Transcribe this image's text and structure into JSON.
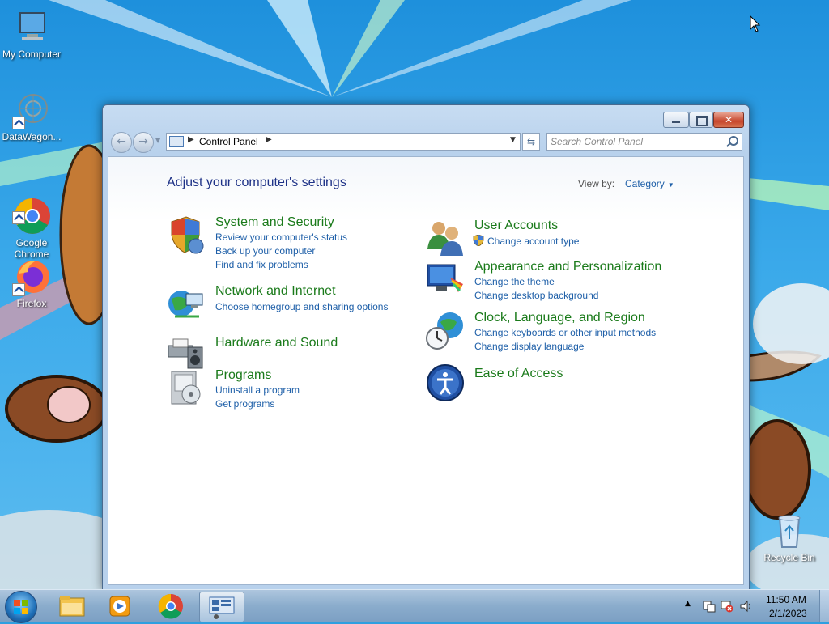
{
  "desktop": {
    "icons": [
      {
        "label": "My Computer"
      },
      {
        "label": "DataWagon..."
      },
      {
        "label": "Google\nChrome"
      },
      {
        "label": "Firefox"
      },
      {
        "label": "Recycle Bin"
      }
    ]
  },
  "window": {
    "address": {
      "path": "Control Panel"
    },
    "search": {
      "placeholder": "Search Control Panel"
    },
    "title": "Adjust your computer's settings",
    "view_by": {
      "label": "View by:",
      "value": "Category"
    },
    "categories": [
      {
        "title": "System and Security",
        "links": [
          "Review your computer's status",
          "Back up your computer",
          "Find and fix problems"
        ]
      },
      {
        "title": "Network and Internet",
        "links": [
          "Choose homegroup and sharing options"
        ]
      },
      {
        "title": "Hardware and Sound",
        "links": []
      },
      {
        "title": "Programs",
        "links": [
          "Uninstall a program",
          "Get programs"
        ]
      },
      {
        "title": "User Accounts",
        "links": [
          "Change account type"
        ]
      },
      {
        "title": "Appearance and Personalization",
        "links": [
          "Change the theme",
          "Change desktop background"
        ]
      },
      {
        "title": "Clock, Language, and Region",
        "links": [
          "Change keyboards or other input methods",
          "Change display language"
        ]
      },
      {
        "title": "Ease of Access",
        "links": []
      }
    ]
  },
  "taskbar": {
    "clock": {
      "time": "11:50 AM",
      "date": "2/1/2023"
    }
  },
  "colors": {
    "category_title": "#1a7a1a",
    "link": "#1e5fa8",
    "heading": "#1e3287",
    "taskbar": "#8aaccc"
  }
}
